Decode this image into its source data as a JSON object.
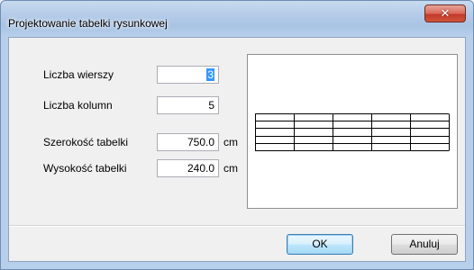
{
  "window": {
    "title": "Projektowanie tabelki rysunkowej",
    "close_glyph": "✕"
  },
  "fields": {
    "rows": {
      "label": "Liczba wierszy",
      "value": "3"
    },
    "cols": {
      "label": "Liczba kolumn",
      "value": "5"
    },
    "width": {
      "label": "Szerokość tabelki",
      "value": "750.0",
      "unit": "cm"
    },
    "height": {
      "label": "Wysokość tabelki",
      "value": "240.0",
      "unit": "cm"
    }
  },
  "buttons": {
    "ok": "OK",
    "cancel": "Anuluj"
  },
  "preview": {
    "rows": 3,
    "cols": 5,
    "table_width_cm": 750.0,
    "table_height_cm": 240.0
  },
  "colors": {
    "titlebar": "#b6cde9",
    "close_button": "#c2392a",
    "dialog_bg": "#f0f0f0",
    "selection": "#3399ff"
  }
}
